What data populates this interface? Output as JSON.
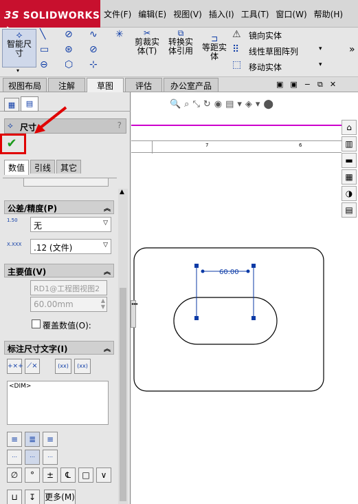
{
  "app": {
    "logo_ds": "3S",
    "logo_text": "SOLIDWORKS"
  },
  "menus": [
    "文件(F)",
    "编辑(E)",
    "视图(V)",
    "插入(I)",
    "工具(T)",
    "窗口(W)",
    "帮助(H)"
  ],
  "toolbar": {
    "smart_dim_line1": "智能尺",
    "smart_dim_line2": "寸",
    "trim_line1": "剪裁实",
    "trim_line2": "体(T)",
    "convert_line1": "转换实",
    "convert_line2": "体引用",
    "offset_line1": "等距实",
    "offset_line2": "体",
    "mirror": "镜向实体",
    "linear_pattern": "线性草图阵列",
    "move": "移动实体",
    "more": "»"
  },
  "tabs": [
    "视图布局",
    "注解",
    "草图",
    "评估",
    "办公室产品"
  ],
  "active_tab": "草图",
  "panel": {
    "title": "尺寸",
    "help": "?",
    "ok_icon": "✔",
    "subtabs": [
      "数值",
      "引线",
      "其它"
    ],
    "tolerance": {
      "header": "公差/精度(P)",
      "tol_type": "无",
      "precision": ".12 (文件)",
      "tol_icon_a": "1.50",
      "tol_icon_b": "X.XXX"
    },
    "primary": {
      "header": "主要值(V)",
      "ref_name": "RD1@工程图视图2",
      "value": "60.00mm",
      "override_label": "覆盖数值(O):"
    },
    "dim_text": {
      "header": "标注尺寸文字(I)",
      "content": "<DIM>",
      "more": "更多(M)",
      "paren": "(xx)",
      "box": "(xx)"
    }
  },
  "canvas": {
    "dim_value": "60.00",
    "ruler_a": "7",
    "ruler_b": "6"
  },
  "colors": {
    "brand": "#c8102e",
    "annotation": "#0b3aa6",
    "highlight": "#e00000",
    "magenta": "#cc00cc"
  }
}
